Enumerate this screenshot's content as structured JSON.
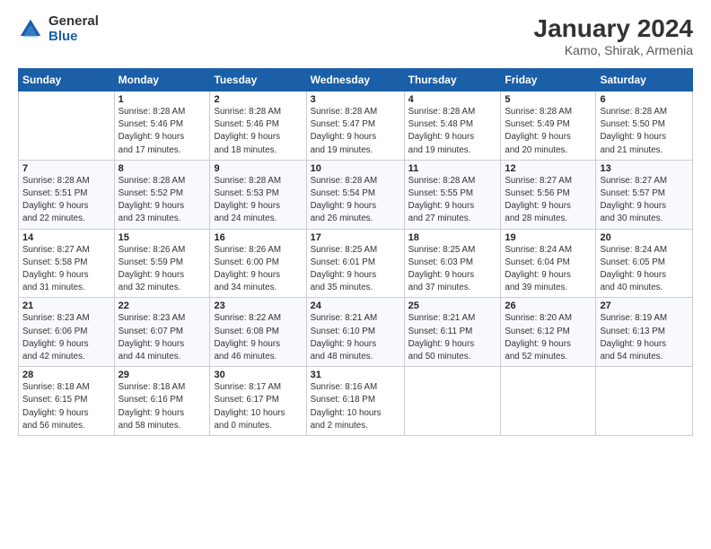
{
  "header": {
    "logo_general": "General",
    "logo_blue": "Blue",
    "month_title": "January 2024",
    "location": "Kamo, Shirak, Armenia"
  },
  "days_of_week": [
    "Sunday",
    "Monday",
    "Tuesday",
    "Wednesday",
    "Thursday",
    "Friday",
    "Saturday"
  ],
  "weeks": [
    [
      {
        "day": "",
        "info": ""
      },
      {
        "day": "1",
        "info": "Sunrise: 8:28 AM\nSunset: 5:46 PM\nDaylight: 9 hours\nand 17 minutes."
      },
      {
        "day": "2",
        "info": "Sunrise: 8:28 AM\nSunset: 5:46 PM\nDaylight: 9 hours\nand 18 minutes."
      },
      {
        "day": "3",
        "info": "Sunrise: 8:28 AM\nSunset: 5:47 PM\nDaylight: 9 hours\nand 19 minutes."
      },
      {
        "day": "4",
        "info": "Sunrise: 8:28 AM\nSunset: 5:48 PM\nDaylight: 9 hours\nand 19 minutes."
      },
      {
        "day": "5",
        "info": "Sunrise: 8:28 AM\nSunset: 5:49 PM\nDaylight: 9 hours\nand 20 minutes."
      },
      {
        "day": "6",
        "info": "Sunrise: 8:28 AM\nSunset: 5:50 PM\nDaylight: 9 hours\nand 21 minutes."
      }
    ],
    [
      {
        "day": "7",
        "info": "Sunrise: 8:28 AM\nSunset: 5:51 PM\nDaylight: 9 hours\nand 22 minutes."
      },
      {
        "day": "8",
        "info": "Sunrise: 8:28 AM\nSunset: 5:52 PM\nDaylight: 9 hours\nand 23 minutes."
      },
      {
        "day": "9",
        "info": "Sunrise: 8:28 AM\nSunset: 5:53 PM\nDaylight: 9 hours\nand 24 minutes."
      },
      {
        "day": "10",
        "info": "Sunrise: 8:28 AM\nSunset: 5:54 PM\nDaylight: 9 hours\nand 26 minutes."
      },
      {
        "day": "11",
        "info": "Sunrise: 8:28 AM\nSunset: 5:55 PM\nDaylight: 9 hours\nand 27 minutes."
      },
      {
        "day": "12",
        "info": "Sunrise: 8:27 AM\nSunset: 5:56 PM\nDaylight: 9 hours\nand 28 minutes."
      },
      {
        "day": "13",
        "info": "Sunrise: 8:27 AM\nSunset: 5:57 PM\nDaylight: 9 hours\nand 30 minutes."
      }
    ],
    [
      {
        "day": "14",
        "info": "Sunrise: 8:27 AM\nSunset: 5:58 PM\nDaylight: 9 hours\nand 31 minutes."
      },
      {
        "day": "15",
        "info": "Sunrise: 8:26 AM\nSunset: 5:59 PM\nDaylight: 9 hours\nand 32 minutes."
      },
      {
        "day": "16",
        "info": "Sunrise: 8:26 AM\nSunset: 6:00 PM\nDaylight: 9 hours\nand 34 minutes."
      },
      {
        "day": "17",
        "info": "Sunrise: 8:25 AM\nSunset: 6:01 PM\nDaylight: 9 hours\nand 35 minutes."
      },
      {
        "day": "18",
        "info": "Sunrise: 8:25 AM\nSunset: 6:03 PM\nDaylight: 9 hours\nand 37 minutes."
      },
      {
        "day": "19",
        "info": "Sunrise: 8:24 AM\nSunset: 6:04 PM\nDaylight: 9 hours\nand 39 minutes."
      },
      {
        "day": "20",
        "info": "Sunrise: 8:24 AM\nSunset: 6:05 PM\nDaylight: 9 hours\nand 40 minutes."
      }
    ],
    [
      {
        "day": "21",
        "info": "Sunrise: 8:23 AM\nSunset: 6:06 PM\nDaylight: 9 hours\nand 42 minutes."
      },
      {
        "day": "22",
        "info": "Sunrise: 8:23 AM\nSunset: 6:07 PM\nDaylight: 9 hours\nand 44 minutes."
      },
      {
        "day": "23",
        "info": "Sunrise: 8:22 AM\nSunset: 6:08 PM\nDaylight: 9 hours\nand 46 minutes."
      },
      {
        "day": "24",
        "info": "Sunrise: 8:21 AM\nSunset: 6:10 PM\nDaylight: 9 hours\nand 48 minutes."
      },
      {
        "day": "25",
        "info": "Sunrise: 8:21 AM\nSunset: 6:11 PM\nDaylight: 9 hours\nand 50 minutes."
      },
      {
        "day": "26",
        "info": "Sunrise: 8:20 AM\nSunset: 6:12 PM\nDaylight: 9 hours\nand 52 minutes."
      },
      {
        "day": "27",
        "info": "Sunrise: 8:19 AM\nSunset: 6:13 PM\nDaylight: 9 hours\nand 54 minutes."
      }
    ],
    [
      {
        "day": "28",
        "info": "Sunrise: 8:18 AM\nSunset: 6:15 PM\nDaylight: 9 hours\nand 56 minutes."
      },
      {
        "day": "29",
        "info": "Sunrise: 8:18 AM\nSunset: 6:16 PM\nDaylight: 9 hours\nand 58 minutes."
      },
      {
        "day": "30",
        "info": "Sunrise: 8:17 AM\nSunset: 6:17 PM\nDaylight: 10 hours\nand 0 minutes."
      },
      {
        "day": "31",
        "info": "Sunrise: 8:16 AM\nSunset: 6:18 PM\nDaylight: 10 hours\nand 2 minutes."
      },
      {
        "day": "",
        "info": ""
      },
      {
        "day": "",
        "info": ""
      },
      {
        "day": "",
        "info": ""
      }
    ]
  ]
}
